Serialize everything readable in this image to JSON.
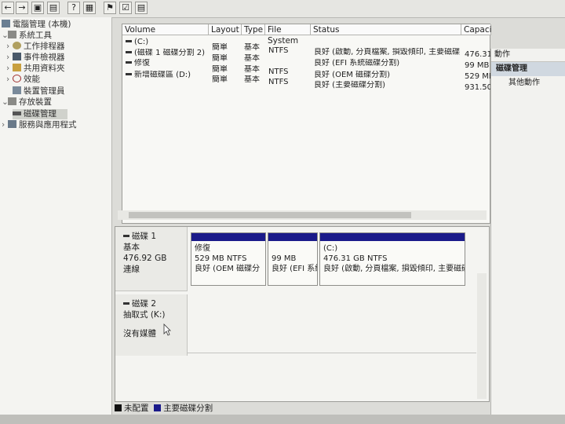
{
  "toolbar": {
    "icons": [
      "back-arrow-icon",
      "forward-arrow-icon",
      "folder-icon",
      "console-icon",
      "help-icon",
      "pane-icon",
      "flag-icon",
      "check-icon",
      "properties-icon"
    ],
    "glyphs": [
      "←",
      "→",
      "▣",
      "▤",
      "?",
      "▦",
      "⚑",
      "☑",
      "▤"
    ]
  },
  "tree": {
    "root": "電腦管理 (本機)",
    "system_tools": "系統工具",
    "task_scheduler": "工作排程器",
    "event_viewer": "事件檢視器",
    "shared_folders": "共用資料夾",
    "performance": "效能",
    "device_manager": "裝置管理員",
    "storage": "存放裝置",
    "disk_management": "磁碟管理",
    "services": "服務與應用程式"
  },
  "list": {
    "headers": [
      "Volume",
      "Layout",
      "Type",
      "File System",
      "Status",
      "Capaci"
    ],
    "rows": [
      {
        "volume": "(C:)",
        "layout": "簡單",
        "type": "基本",
        "fs": "NTFS",
        "status": "良好 (啟動, 分頁檔案, 損毀傾印, 主要磁碟分",
        "cap": "476.31"
      },
      {
        "volume": "(磁碟 1 磁碟分割 2)",
        "layout": "簡單",
        "type": "基本",
        "fs": "",
        "status": "良好 (EFI 系統磁碟分割)",
        "cap": "99 MB"
      },
      {
        "volume": "修復",
        "layout": "簡單",
        "type": "基本",
        "fs": "NTFS",
        "status": "良好 (OEM 磁碟分割)",
        "cap": "529 MB"
      },
      {
        "volume": "新增磁碟區 (D:)",
        "layout": "簡單",
        "type": "基本",
        "fs": "NTFS",
        "status": "良好 (主要磁碟分割)",
        "cap": "931.50"
      }
    ]
  },
  "disks": {
    "disk1": {
      "name": "磁碟 1",
      "type": "基本",
      "size": "476.92 GB",
      "status": "連線"
    },
    "disk1_parts": [
      {
        "name": "修復",
        "size": "529 MB NTFS",
        "status": "良好 (OEM 磁碟分"
      },
      {
        "name": "",
        "size": "99 MB",
        "status": "良好 (EFI 系統"
      },
      {
        "name": "(C:)",
        "size": "476.31 GB NTFS",
        "status": "良好 (啟動, 分頁檔案, 損毀傾印, 主要磁碟分"
      }
    ],
    "disk2": {
      "name": "磁碟 2",
      "type": "抽取式 (K:)",
      "media": "沒有媒體"
    }
  },
  "actions": {
    "header": "動作",
    "selected": "磁碟管理",
    "more": "其他動作"
  },
  "legend": {
    "unallocated": "未配置",
    "primary": "主要磁碟分割",
    "unallocated_color": "#111111",
    "primary_color": "#1a1a8a"
  }
}
